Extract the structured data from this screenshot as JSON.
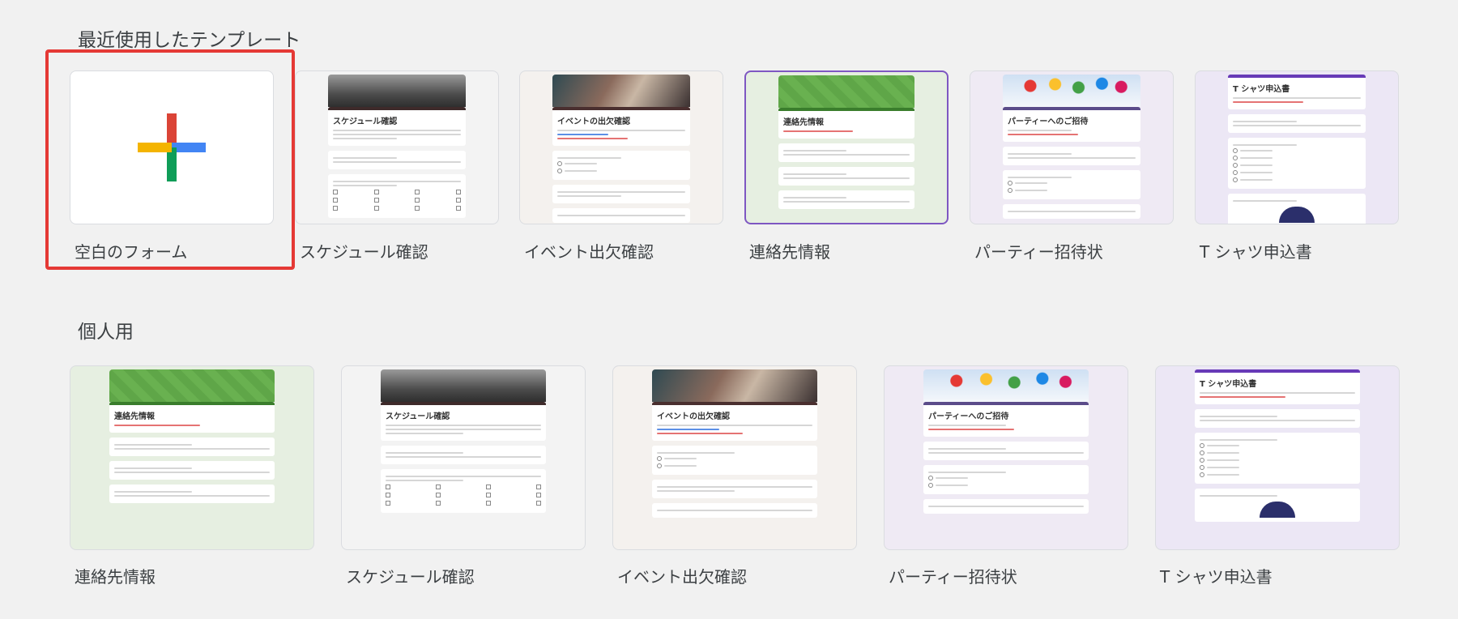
{
  "sections": {
    "recent": {
      "title": "最近使用したテンプレート"
    },
    "personal": {
      "title": "個人用"
    }
  },
  "recent_templates": [
    {
      "label": "空白のフォーム",
      "kind": "blank",
      "selected": true,
      "icon": "plus-icon"
    },
    {
      "label": "スケジュール確認",
      "kind": "schedule",
      "form_title": "スケジュール確認"
    },
    {
      "label": "イベント出欠確認",
      "kind": "event",
      "form_title": "イベントの出欠確認"
    },
    {
      "label": "連絡先情報",
      "kind": "contact",
      "form_title": "連絡先情報",
      "focused": true
    },
    {
      "label": "パーティー招待状",
      "kind": "party",
      "form_title": "パーティーへのご招待"
    },
    {
      "label": "T シャツ申込書",
      "kind": "tshirt",
      "form_title": "T シャツ申込書"
    }
  ],
  "personal_templates": [
    {
      "label": "連絡先情報",
      "kind": "contact",
      "form_title": "連絡先情報"
    },
    {
      "label": "スケジュール確認",
      "kind": "schedule",
      "form_title": "スケジュール確認"
    },
    {
      "label": "イベント出欠確認",
      "kind": "event",
      "form_title": "イベントの出欠確認"
    },
    {
      "label": "パーティー招待状",
      "kind": "party",
      "form_title": "パーティーへのご招待"
    },
    {
      "label": "T シャツ申込書",
      "kind": "tshirt",
      "form_title": "T シャツ申込書"
    }
  ],
  "colors": {
    "selection": "#e53935",
    "focus": "#7e57c2",
    "contact_bg": "#e6efe1",
    "contact_header": "#5fa648",
    "schedule_bg": "#f3f3f3",
    "schedule_header": "#6b6b6b",
    "event_bg": "#f4f1ee",
    "event_header": "#7a5a48",
    "party_bg": "#efeaf4",
    "party_header": "#9bb7d8",
    "tshirt_bg": "#ece7f5",
    "tshirt_accent": "#673ab7"
  }
}
